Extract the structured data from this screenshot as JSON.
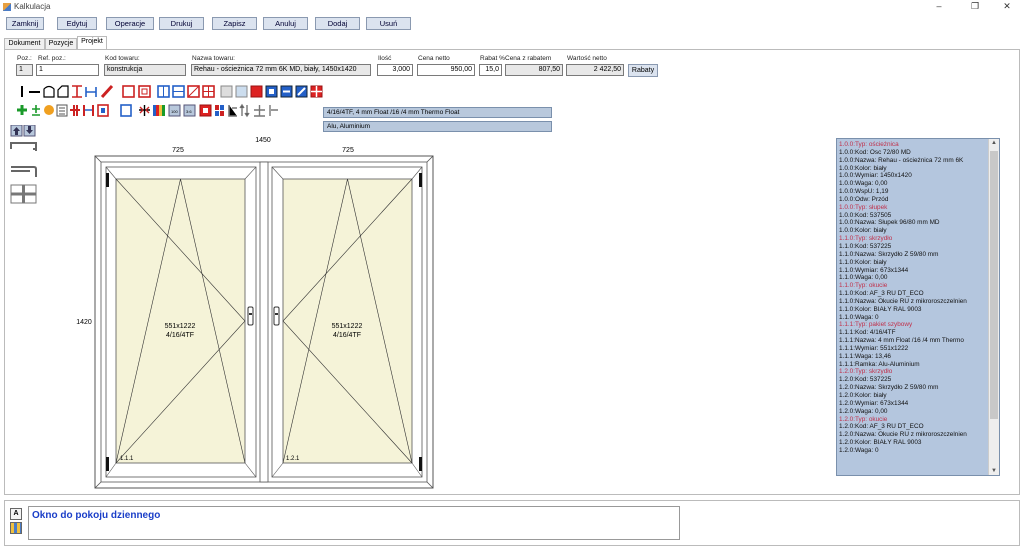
{
  "window": {
    "title": "Kalkulacja"
  },
  "toolbar": [
    "Zamknij",
    "Edytuj",
    "Operacje",
    "Drukuj",
    "Zapisz",
    "Anuluj",
    "Dodaj",
    "Usuń"
  ],
  "tabs": [
    "Dokument",
    "Pozycje",
    "Projekt"
  ],
  "fields": {
    "poz_label": "Poz.:",
    "poz": "1",
    "ref_label": "Ref. poz.:",
    "ref": "1",
    "kod_label": "Kod towaru:",
    "kod": "konstrukcja",
    "nazwa_label": "Nazwa towaru:",
    "nazwa": "Rehau - ościeżnica 72 mm 6K MD, biały, 1450x1420",
    "ilosc_label": "Ilość",
    "ilosc": "3,000",
    "cena_label": "Cena netto",
    "cena": "950,00",
    "rabat_label": "Rabat %",
    "rabat": "15,0",
    "cena_rab_label": "Cena z rabatem",
    "cena_rab": "807,50",
    "wartosc_label": "Wartość netto",
    "wartosc": "2 422,50",
    "rabaty_button": "Rabaty"
  },
  "info": {
    "glass": "4/16/4TF, 4 mm Float /16 /4 mm Thermo Float",
    "alu": "Alu, Aluminium"
  },
  "drawing": {
    "total_width": "1450",
    "left_width": "725",
    "right_width": "725",
    "height": "1420",
    "left_sash": {
      "size": "551x1222",
      "glass": "4/16/4TF",
      "code": "1.1.1"
    },
    "right_sash": {
      "size": "551x1222",
      "glass": "4/16/4TF",
      "code": "1.2.1"
    }
  },
  "tree": [
    {
      "t": 1,
      "s": "1.0.0:Typ: ościeżnica"
    },
    {
      "t": 0,
      "s": "1.0.0:Kod: Osc 72/80 MD"
    },
    {
      "t": 0,
      "s": "1.0.0:Nazwa: Rehau - ościeżnica 72 mm 6K"
    },
    {
      "t": 0,
      "s": "1.0.0:Kolor: biały"
    },
    {
      "t": 0,
      "s": "1.0.0:Wymiar: 1450x1420"
    },
    {
      "t": 0,
      "s": "1.0.0:Waga: 0,00"
    },
    {
      "t": 0,
      "s": "1.0.0:WspU: 1,19"
    },
    {
      "t": 0,
      "s": "1.0.0:Odw: Przód"
    },
    {
      "t": 1,
      "s": "1.0.0:Typ: słupek"
    },
    {
      "t": 0,
      "s": "1.0.0:Kod: 537505"
    },
    {
      "t": 0,
      "s": "1.0.0:Nazwa: Słupek 96/80 mm MD"
    },
    {
      "t": 0,
      "s": "1.0.0:Kolor: biały"
    },
    {
      "t": 1,
      "s": "1.1.0:Typ: skrzydło"
    },
    {
      "t": 0,
      "s": "1.1.0:Kod: 537225"
    },
    {
      "t": 0,
      "s": "1.1.0:Nazwa: Skrzydło Z 59/80 mm"
    },
    {
      "t": 0,
      "s": "1.1.0:Kolor: biały"
    },
    {
      "t": 0,
      "s": "1.1.0:Wymiar: 673x1344"
    },
    {
      "t": 0,
      "s": "1.1.0:Waga: 0,00"
    },
    {
      "t": 1,
      "s": "1.1.0:Typ: okucie"
    },
    {
      "t": 0,
      "s": "1.1.0:Kod: AF_3 RU DT_ECO"
    },
    {
      "t": 0,
      "s": "1.1.0:Nazwa: Okucie RU z mikroroszczelnien"
    },
    {
      "t": 0,
      "s": "1.1.0:Kolor: BIAŁY RAL 9003"
    },
    {
      "t": 0,
      "s": "1.1.0:Waga: 0"
    },
    {
      "t": 1,
      "s": "1.1.1:Typ: pakiet szybowy"
    },
    {
      "t": 0,
      "s": "1.1.1:Kod: 4/16/4TF"
    },
    {
      "t": 0,
      "s": "1.1.1:Nazwa: 4 mm Float /16 /4 mm Thermo"
    },
    {
      "t": 0,
      "s": "1.1.1:Wymiar: 551x1222"
    },
    {
      "t": 0,
      "s": "1.1.1:Waga: 13,46"
    },
    {
      "t": 0,
      "s": "1.1.1:Ramka: Alu-Aluminium"
    },
    {
      "t": 1,
      "s": "1.2.0:Typ: skrzydło"
    },
    {
      "t": 0,
      "s": "1.2.0:Kod: 537225"
    },
    {
      "t": 0,
      "s": "1.2.0:Nazwa: Skrzydło Z 59/80 mm"
    },
    {
      "t": 0,
      "s": "1.2.0:Kolor: biały"
    },
    {
      "t": 0,
      "s": "1.2.0:Wymiar: 673x1344"
    },
    {
      "t": 0,
      "s": "1.2.0:Waga: 0,00"
    },
    {
      "t": 1,
      "s": "1.2.0:Typ: okucie"
    },
    {
      "t": 0,
      "s": "1.2.0:Kod: AF_3 RU DT_ECO"
    },
    {
      "t": 0,
      "s": "1.2.0:Nazwa: Okucie RU z mikroroszczelnien"
    },
    {
      "t": 0,
      "s": "1.2.0:Kolor: BIAŁY RAL 9003"
    },
    {
      "t": 0,
      "s": "1.2.0:Waga: 0"
    }
  ],
  "description": "Okno do pokoju dziennego",
  "colors": {
    "glass": "#f5f3d8",
    "tree_bg": "#b4c6de",
    "type_text": "#c0304a",
    "desc_text": "#1a3ec8"
  }
}
